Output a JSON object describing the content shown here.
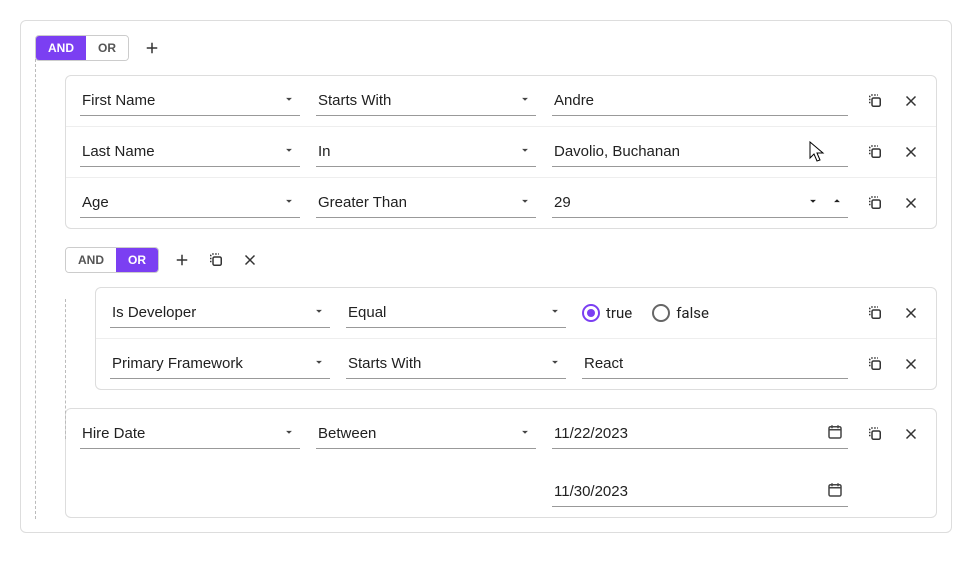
{
  "root": {
    "and_label": "AND",
    "or_label": "OR",
    "active": "and"
  },
  "rules": [
    {
      "field": "First Name",
      "operator": "Starts With",
      "value": "Andre"
    },
    {
      "field": "Last Name",
      "operator": "In",
      "value": "Davolio, Buchanan"
    },
    {
      "field": "Age",
      "operator": "Greater Than",
      "value": "29",
      "is_number": true
    }
  ],
  "nested": {
    "and_label": "AND",
    "or_label": "OR",
    "active": "or",
    "rules": [
      {
        "field": "Is Developer",
        "operator": "Equal",
        "bool_true": "true",
        "bool_false": "false",
        "selected": "true"
      },
      {
        "field": "Primary Framework",
        "operator": "Starts With",
        "value": "React"
      }
    ]
  },
  "date_rule": {
    "field": "Hire Date",
    "operator": "Between",
    "value1": "11/22/2023",
    "value2": "11/30/2023"
  }
}
